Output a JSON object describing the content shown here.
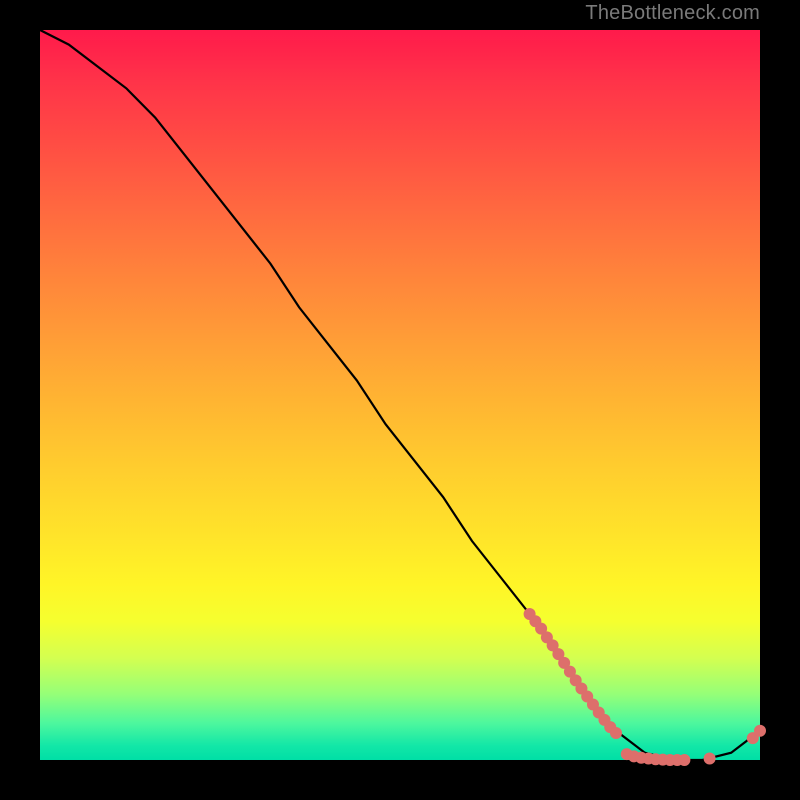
{
  "attribution": "TheBottleneck.com",
  "colors": {
    "background": "#000000",
    "line": "#000000",
    "points": "#dd6f6b",
    "gradient_top": "#ff1a4b",
    "gradient_bottom": "#00dfa6"
  },
  "chart_data": {
    "type": "line",
    "title": "",
    "xlabel": "",
    "ylabel": "",
    "xlim": [
      0,
      100
    ],
    "ylim": [
      0,
      100
    ],
    "grid": false,
    "legend": false,
    "series": [
      {
        "name": "bottleneck-curve",
        "x": [
          0,
          4,
          8,
          12,
          16,
          20,
          24,
          28,
          32,
          36,
          40,
          44,
          48,
          52,
          56,
          60,
          64,
          68,
          72,
          76,
          80,
          84,
          88,
          92,
          96,
          100
        ],
        "values": [
          100,
          98,
          95,
          92,
          88,
          83,
          78,
          73,
          68,
          62,
          57,
          52,
          46,
          41,
          36,
          30,
          25,
          20,
          14,
          9,
          4,
          1,
          0,
          0,
          1,
          4
        ]
      }
    ],
    "points": [
      {
        "x": 68.0,
        "y": 20.0
      },
      {
        "x": 68.8,
        "y": 19.0
      },
      {
        "x": 69.6,
        "y": 18.0
      },
      {
        "x": 70.4,
        "y": 16.8
      },
      {
        "x": 71.2,
        "y": 15.7
      },
      {
        "x": 72.0,
        "y": 14.5
      },
      {
        "x": 72.8,
        "y": 13.3
      },
      {
        "x": 73.6,
        "y": 12.1
      },
      {
        "x": 74.4,
        "y": 10.9
      },
      {
        "x": 75.2,
        "y": 9.8
      },
      {
        "x": 76.0,
        "y": 8.7
      },
      {
        "x": 76.8,
        "y": 7.6
      },
      {
        "x": 77.6,
        "y": 6.5
      },
      {
        "x": 78.4,
        "y": 5.5
      },
      {
        "x": 79.2,
        "y": 4.5
      },
      {
        "x": 80.0,
        "y": 3.7
      },
      {
        "x": 81.5,
        "y": 0.8
      },
      {
        "x": 82.5,
        "y": 0.5
      },
      {
        "x": 83.5,
        "y": 0.3
      },
      {
        "x": 84.5,
        "y": 0.2
      },
      {
        "x": 85.5,
        "y": 0.1
      },
      {
        "x": 86.5,
        "y": 0.05
      },
      {
        "x": 87.5,
        "y": 0.0
      },
      {
        "x": 88.5,
        "y": 0.0
      },
      {
        "x": 89.5,
        "y": 0.0
      },
      {
        "x": 93.0,
        "y": 0.2
      },
      {
        "x": 99.0,
        "y": 3.0
      },
      {
        "x": 100.0,
        "y": 4.0
      }
    ]
  }
}
